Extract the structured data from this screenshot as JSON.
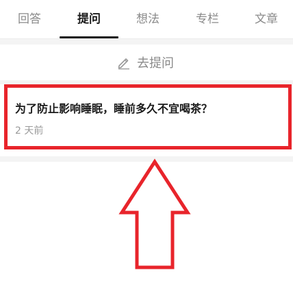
{
  "tabs": [
    {
      "label": "回答",
      "active": false
    },
    {
      "label": "提问",
      "active": true
    },
    {
      "label": "想法",
      "active": false
    },
    {
      "label": "专栏",
      "active": false
    },
    {
      "label": "文章",
      "active": false
    }
  ],
  "ask": {
    "label": "去提问",
    "icon": "pencil-icon"
  },
  "question": {
    "title": "为了防止影响睡眠，睡前多久不宜喝茶？",
    "time": "2 天前"
  },
  "colors": {
    "highlight": "#e8242b",
    "active_tab": "#1a1a1a",
    "inactive_tab": "#8a8a8a",
    "background_gray": "#f4f4f4"
  }
}
